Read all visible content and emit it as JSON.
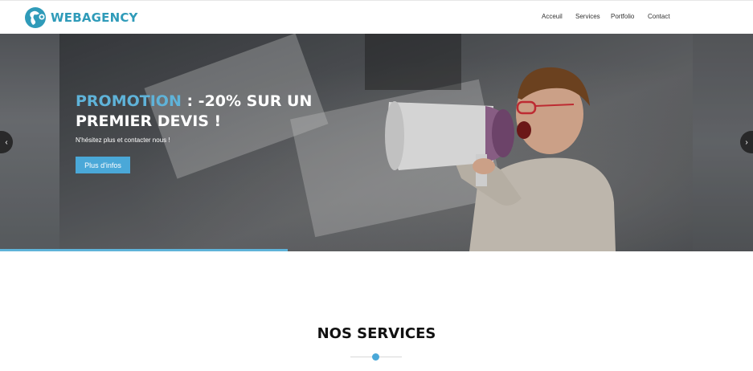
{
  "brand": {
    "name": "WEBAGENCY",
    "accent_color": "#2f9bb9"
  },
  "nav": {
    "items": [
      {
        "label": "Acceuil"
      },
      {
        "label": "Services"
      },
      {
        "label": "Portfolio"
      },
      {
        "label": "Contact"
      }
    ]
  },
  "hero": {
    "headline_accent": "PROMOTION",
    "headline_rest": " : -20% SUR UN PREMIER DEVIS !",
    "subline": "N'hésitez plus et contacter nous !",
    "cta_label": "Plus d'infos",
    "accent_color": "#5fb3d9",
    "prev_icon": "chevron-left-icon",
    "next_icon": "chevron-right-icon"
  },
  "services": {
    "title": "NOS SERVICES"
  }
}
